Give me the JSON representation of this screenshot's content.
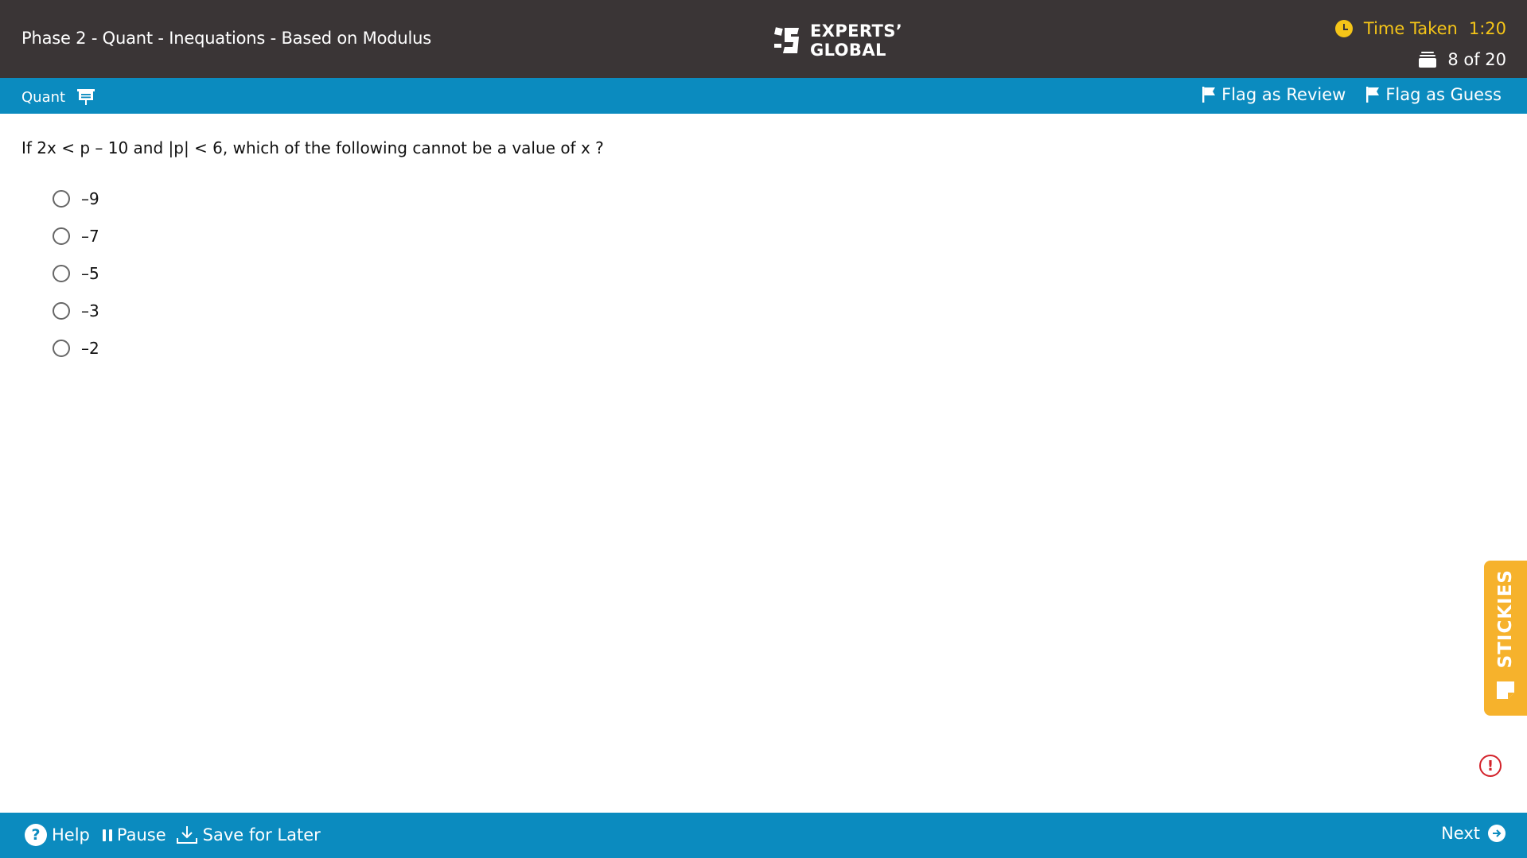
{
  "header": {
    "exam_title": "Phase 2 - Quant - Inequations - Based on Modulus",
    "logo_line1": "EXPERTS’",
    "logo_line2": "GLOBAL",
    "timer_label": "Time Taken",
    "timer_value": "1:20",
    "question_counter": "8 of 20",
    "timer_color": "#f5c518",
    "background_color": "#3a3536"
  },
  "subbar": {
    "section": "Quant",
    "flag_review": "Flag as Review",
    "flag_guess": "Flag as Guess",
    "background_color": "#0b8bbf"
  },
  "question": {
    "text": "If 2x < p – 10 and |p| < 6, which of the following cannot be a value of x ?",
    "options": [
      "–9",
      "–7",
      "–5",
      "–3",
      "–2"
    ]
  },
  "stickies": {
    "label": "STICKIES",
    "color": "#f6b22c"
  },
  "icons": {
    "logo": "experts-global-logo",
    "timer": "clock-icon",
    "counter": "question-stack-icon",
    "section": "presentation-board-icon",
    "flag": "flag-icon",
    "alert": "alert-circle-icon",
    "help": "help-circle-icon",
    "pause": "pause-icon",
    "save": "download-icon",
    "next": "arrow-right-circle-icon"
  },
  "footer": {
    "help": "Help",
    "pause": "Pause",
    "save": "Save for Later",
    "next": "Next"
  }
}
